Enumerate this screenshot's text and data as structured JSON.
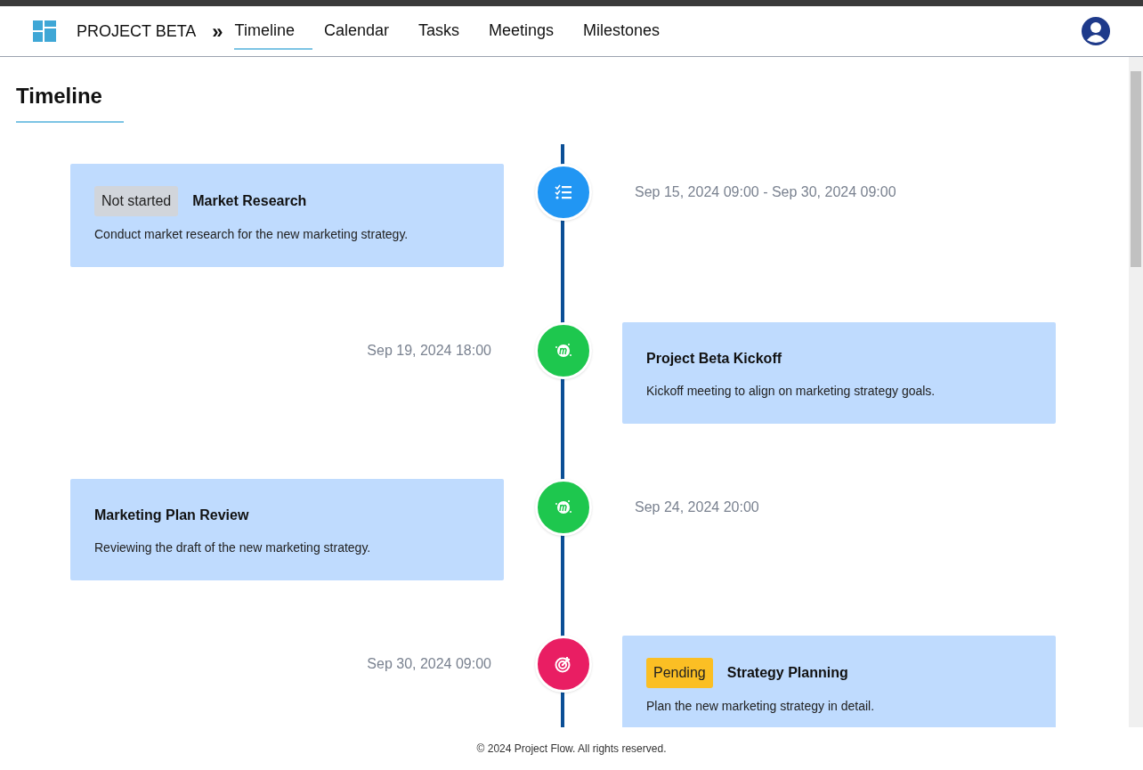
{
  "header": {
    "project": "PROJECT BETA",
    "separator": "»",
    "tabs": [
      {
        "label": "Timeline",
        "selected": true
      },
      {
        "label": "Calendar",
        "selected": false
      },
      {
        "label": "Tasks",
        "selected": false
      },
      {
        "label": "Meetings",
        "selected": false
      },
      {
        "label": "Milestones",
        "selected": false
      }
    ]
  },
  "page_title": "Timeline",
  "events": [
    {
      "kind": "task",
      "title": "Market Research",
      "description": "Conduct market research for the new marketing strategy.",
      "date": "Sep 15, 2024 09:00 - Sep 30, 2024 09:00",
      "status": {
        "label": "Not started",
        "color": "#d1d5db"
      }
    },
    {
      "kind": "meeting",
      "title": "Project Beta Kickoff",
      "description": "Kickoff meeting to align on marketing strategy goals.",
      "date": "Sep 19, 2024 18:00"
    },
    {
      "kind": "meeting",
      "title": "Marketing Plan Review",
      "description": "Reviewing the draft of the new marketing strategy.",
      "date": "Sep 24, 2024 20:00"
    },
    {
      "kind": "milestone",
      "title": "Strategy Planning",
      "description": "Plan the new marketing strategy in detail.",
      "date": "Sep 30, 2024 09:00",
      "status": {
        "label": "Pending",
        "color": "#fbbf24"
      }
    }
  ],
  "footer": "© 2024 Project Flow. All rights reserved."
}
